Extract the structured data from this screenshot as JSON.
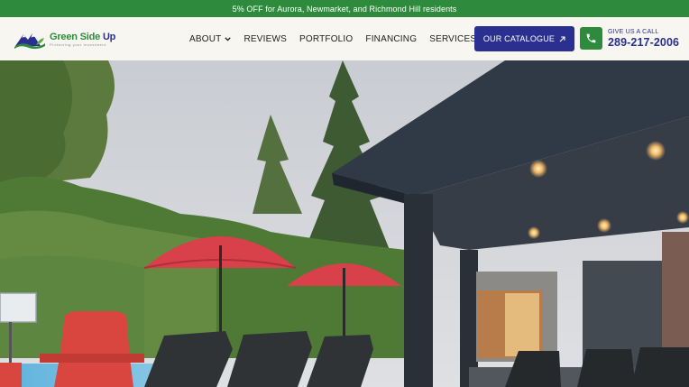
{
  "promo": {
    "text": "5% OFF for Aurora, Newmarket, and Richmond Hill residents"
  },
  "logo": {
    "name_green": "Green Side ",
    "name_blue": "Up",
    "tagline": "Protecting your investment"
  },
  "nav": {
    "items": [
      {
        "label": "ABOUT",
        "has_dropdown": true
      },
      {
        "label": "REVIEWS"
      },
      {
        "label": "PORTFOLIO"
      },
      {
        "label": "FINANCING"
      },
      {
        "label": "SERVICES"
      }
    ]
  },
  "cta": {
    "label": "OUR CATALOGUE"
  },
  "contact": {
    "label": "GIVE US A CALL",
    "phone": "289-217-2006"
  },
  "colors": {
    "brand_green": "#2e8b3d",
    "brand_blue": "#2b2f8f",
    "header_bg": "#f8f6f1"
  },
  "icons": [
    "chevron-down-icon",
    "menu-icon",
    "arrow-up-right-icon",
    "phone-icon"
  ]
}
